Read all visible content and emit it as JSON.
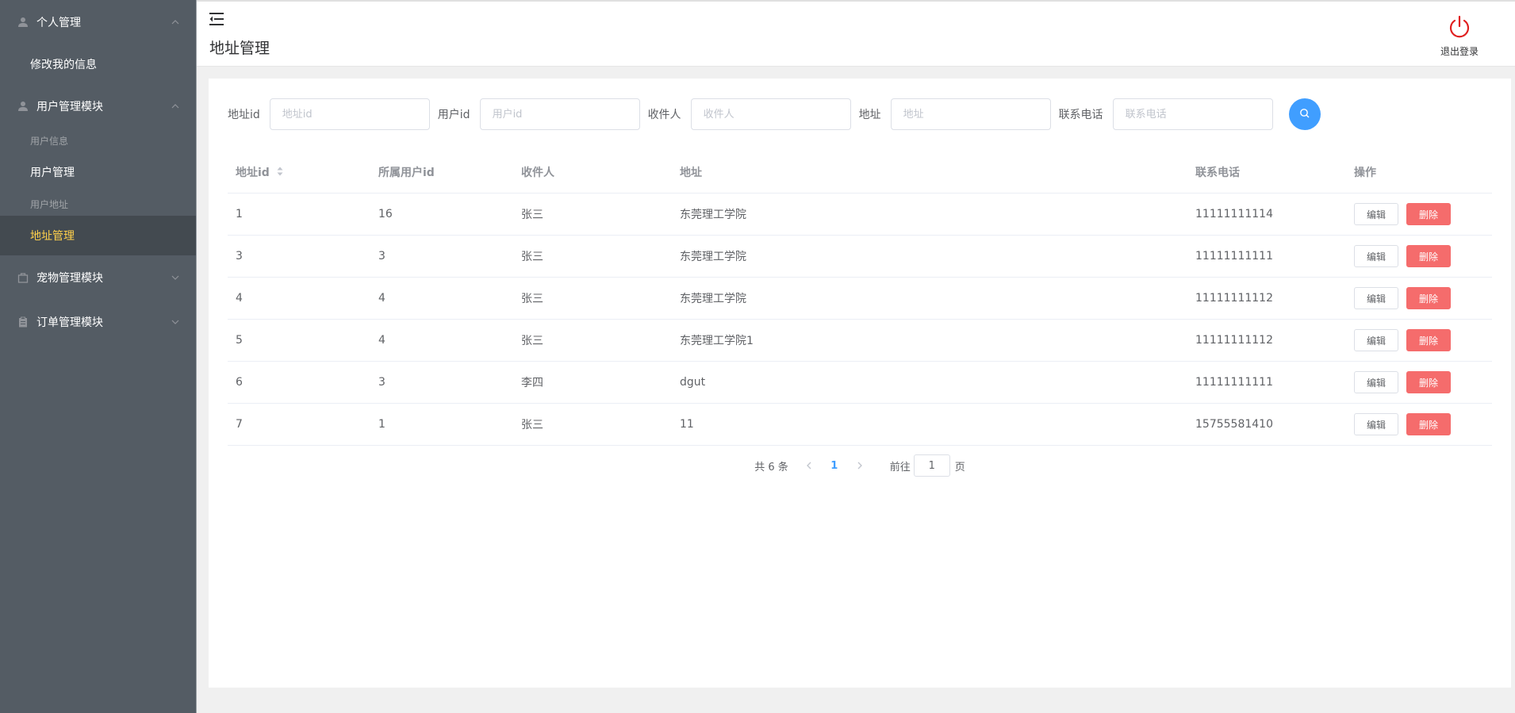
{
  "sidebar": {
    "groups": [
      {
        "label": "个人管理",
        "icon": "user-icon",
        "expanded": true
      },
      {
        "label": "用户管理模块",
        "icon": "user-icon",
        "expanded": true
      },
      {
        "label": "宠物管理模块",
        "icon": "bag-icon",
        "expanded": false
      },
      {
        "label": "订单管理模块",
        "icon": "clipboard-icon",
        "expanded": false
      }
    ],
    "personal_items": [
      "修改我的信息"
    ],
    "user_module_subtitle_1": "用户信息",
    "user_module_item_1": "用户管理",
    "user_module_subtitle_2": "用户地址",
    "user_module_item_2": "地址管理",
    "active_color": "#ffd04b",
    "background": "#545c64"
  },
  "header": {
    "title": "地址管理",
    "logout_label": "退出登录",
    "logout_color": "#e02020"
  },
  "search": {
    "fields": [
      {
        "label": "地址id",
        "placeholder": "地址id",
        "value": ""
      },
      {
        "label": "用户id",
        "placeholder": "用户id",
        "value": ""
      },
      {
        "label": "收件人",
        "placeholder": "收件人",
        "value": ""
      },
      {
        "label": "地址",
        "placeholder": "地址",
        "value": ""
      },
      {
        "label": "联系电话",
        "placeholder": "联系电话",
        "value": ""
      }
    ],
    "button_color": "#409eff"
  },
  "table": {
    "columns": [
      "地址id",
      "所属用户id",
      "收件人",
      "地址",
      "联系电话",
      "操作"
    ],
    "rows": [
      {
        "id": "1",
        "user_id": "16",
        "receiver": "张三",
        "address": "东莞理工学院",
        "phone": "11111111114"
      },
      {
        "id": "3",
        "user_id": "3",
        "receiver": "张三",
        "address": "东莞理工学院",
        "phone": "11111111111"
      },
      {
        "id": "4",
        "user_id": "4",
        "receiver": "张三",
        "address": "东莞理工学院",
        "phone": "11111111112"
      },
      {
        "id": "5",
        "user_id": "4",
        "receiver": "张三",
        "address": "东莞理工学院1",
        "phone": "11111111112"
      },
      {
        "id": "6",
        "user_id": "3",
        "receiver": "李四",
        "address": "dgut",
        "phone": "11111111111"
      },
      {
        "id": "7",
        "user_id": "1",
        "receiver": "张三",
        "address": "11",
        "phone": "15755581410"
      }
    ],
    "edit_label": "编辑",
    "delete_label": "删除",
    "delete_color": "#f56c6c"
  },
  "pagination": {
    "total_text": "共 6 条",
    "current_page": "1",
    "goto_prefix": "前往",
    "goto_value": "1",
    "goto_suffix": "页"
  }
}
